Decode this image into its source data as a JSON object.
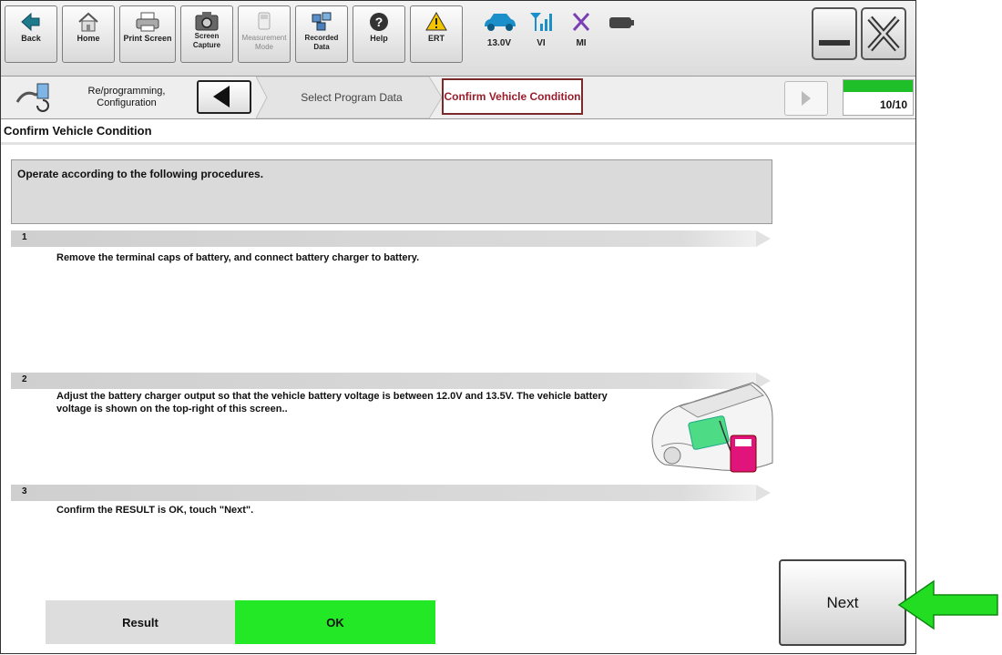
{
  "toolbar": {
    "back": "Back",
    "home": "Home",
    "print_screen": "Print Screen",
    "screen_capture": "Screen Capture",
    "measurement_mode": "Measurement Mode",
    "recorded_data": "Recorded Data",
    "help": "Help",
    "ert": "ERT",
    "voltage": "13.0V",
    "vi": "VI",
    "mi": "MI"
  },
  "breadcrumb": {
    "item1": "Re/programming, Configuration",
    "item2": "Select Program Data",
    "active": "Confirm Vehicle Condition",
    "progress_text": "10/10",
    "progress_fraction": 1.0
  },
  "section_title": "Confirm Vehicle Condition",
  "instructions": "Operate according to the following procedures.",
  "steps": [
    {
      "num": "1",
      "text": "Remove the terminal caps of battery, and connect battery charger to battery."
    },
    {
      "num": "2",
      "text": "Adjust the battery charger output so that the vehicle battery voltage is between 12.0V and 13.5V. The vehicle battery voltage is shown on the top-right of this screen.."
    },
    {
      "num": "3",
      "text": "Confirm the RESULT is OK, touch \"Next\"."
    }
  ],
  "result": {
    "label": "Result",
    "value": "OK"
  },
  "next_label": "Next",
  "colors": {
    "accent_red": "#9b1c2a",
    "ok_green": "#22e826",
    "pointer_green": "#22dd22"
  }
}
